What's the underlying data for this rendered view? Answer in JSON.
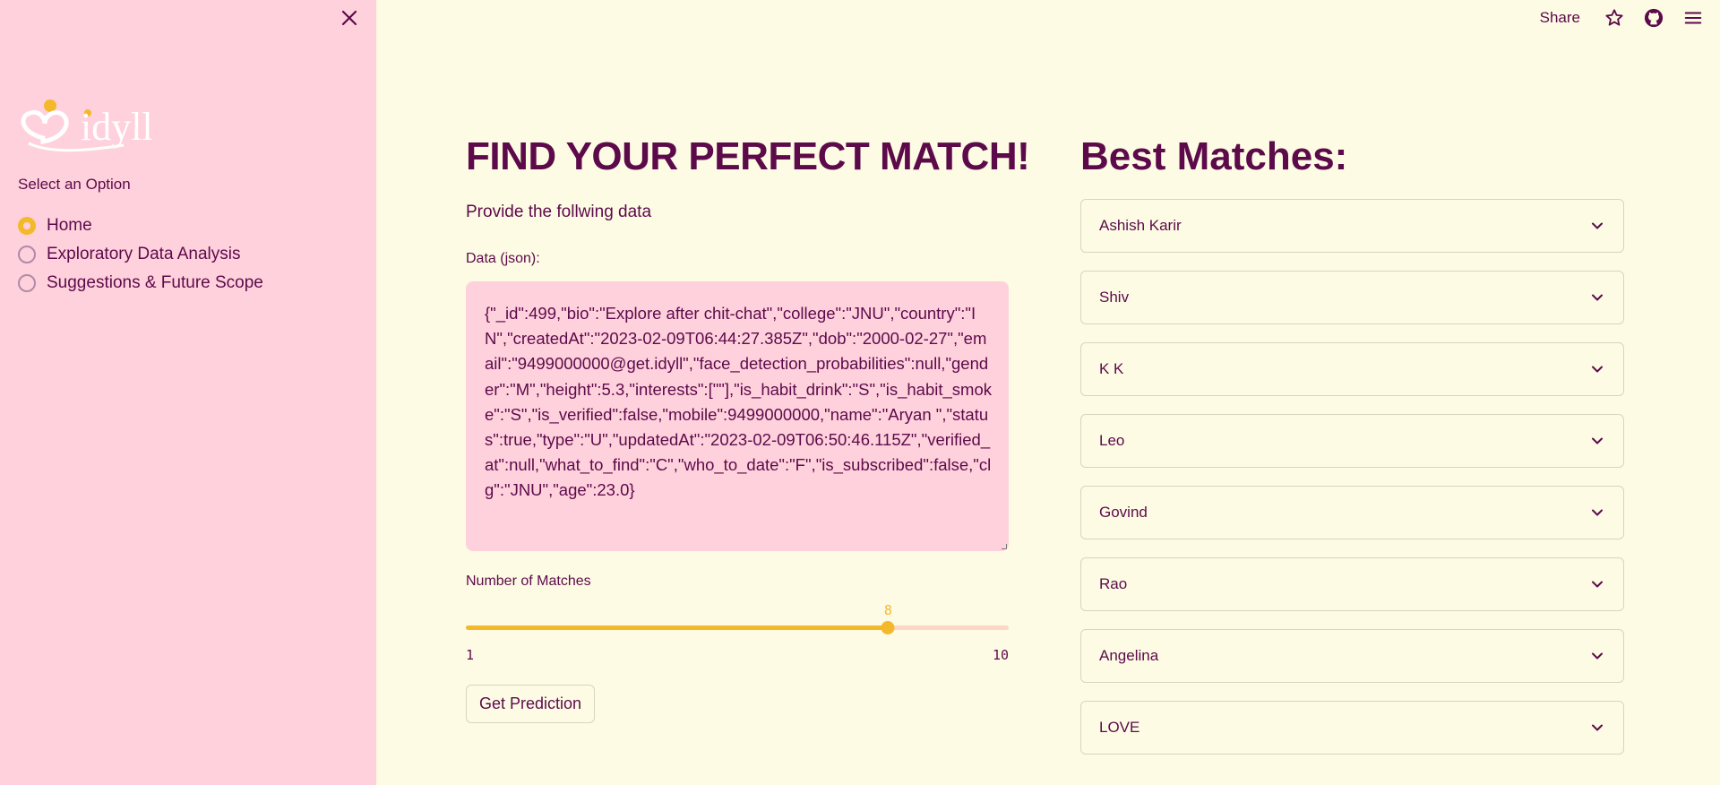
{
  "sidebar": {
    "logo_text": "idyll",
    "select_label": "Select an Option",
    "options": [
      {
        "label": "Home",
        "checked": true
      },
      {
        "label": "Exploratory Data Analysis",
        "checked": false
      },
      {
        "label": "Suggestions & Future Scope",
        "checked": false
      }
    ]
  },
  "header": {
    "share_label": "Share",
    "icons": [
      "star-icon",
      "github-icon",
      "menu-icon"
    ]
  },
  "main": {
    "title": "FIND YOUR PERFECT MATCH!",
    "subtitle": "Provide the follwing data",
    "data_label": "Data (json):",
    "json_value": "{\"_id\":499,\"bio\":\"Explore after chit-chat\",\"college\":\"JNU\",\"country\":\"IN\",\"createdAt\":\"2023-02-09T06:44:27.385Z\",\"dob\":\"2000-02-27\",\"email\":\"9499000000@get.idyll\",\"face_detection_probabilities\":null,\"gender\":\"M\",\"height\":5.3,\"interests\":[\"\"],\"is_habit_drink\":\"S\",\"is_habit_smoke\":\"S\",\"is_verified\":false,\"mobile\":9499000000,\"name\":\"Aryan \",\"status\":true,\"type\":\"U\",\"updatedAt\":\"2023-02-09T06:50:46.115Z\",\"verified_at\":null,\"what_to_find\":\"C\",\"who_to_date\":\"F\",\"is_subscribed\":false,\"clg\":\"JNU\",\"age\":23.0}",
    "matches_label": "Number of Matches",
    "slider": {
      "min": 1,
      "max": 10,
      "value": 8,
      "min_label": "1",
      "max_label": "10",
      "value_label": "8"
    },
    "predict_label": "Get Prediction"
  },
  "results": {
    "title": "Best Matches:",
    "matches": [
      "Ashish Karir",
      "Shiv",
      "K K",
      "Leo",
      "Govind",
      "Rao",
      "Angelina",
      "LOVE"
    ]
  },
  "colors": {
    "accent": "#f4b92b",
    "sidebar_bg": "#ffd1dc",
    "main_bg": "#fdfbe4",
    "text": "#5c0a4a"
  }
}
